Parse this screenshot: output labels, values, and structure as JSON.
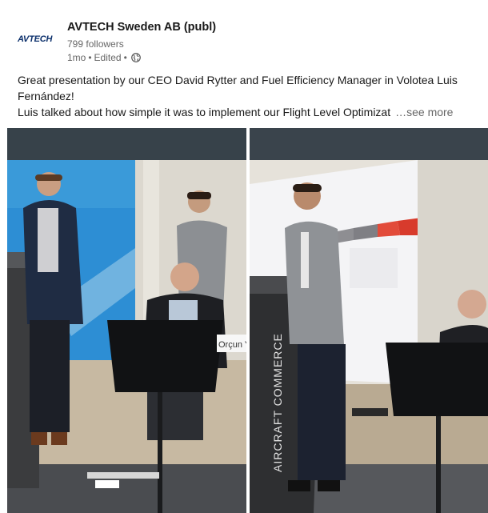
{
  "post": {
    "company_logo_text": "AVTECH",
    "company_name": "AVTECH Sweden AB (publ)",
    "followers": "799 followers",
    "time": "1mo",
    "separator": "•",
    "edited": "Edited",
    "visibility_icon": "globe-icon",
    "text_line1": "Great presentation by our CEO David Rytter and Fuel Efficiency Manager in Volotea Luis Fernández!",
    "text_line2": "Luis talked about how simple it was to implement our Flight Level Optimizat",
    "see_more": "…see more"
  },
  "photos": {
    "left": {
      "name_card": "Orçun Y"
    },
    "right": {
      "banner_text": "AIRCRAFT COMMERCE"
    }
  },
  "colors": {
    "brand_blue": "#0b2f6b",
    "text_primary": "#191919",
    "text_secondary": "#666666"
  }
}
